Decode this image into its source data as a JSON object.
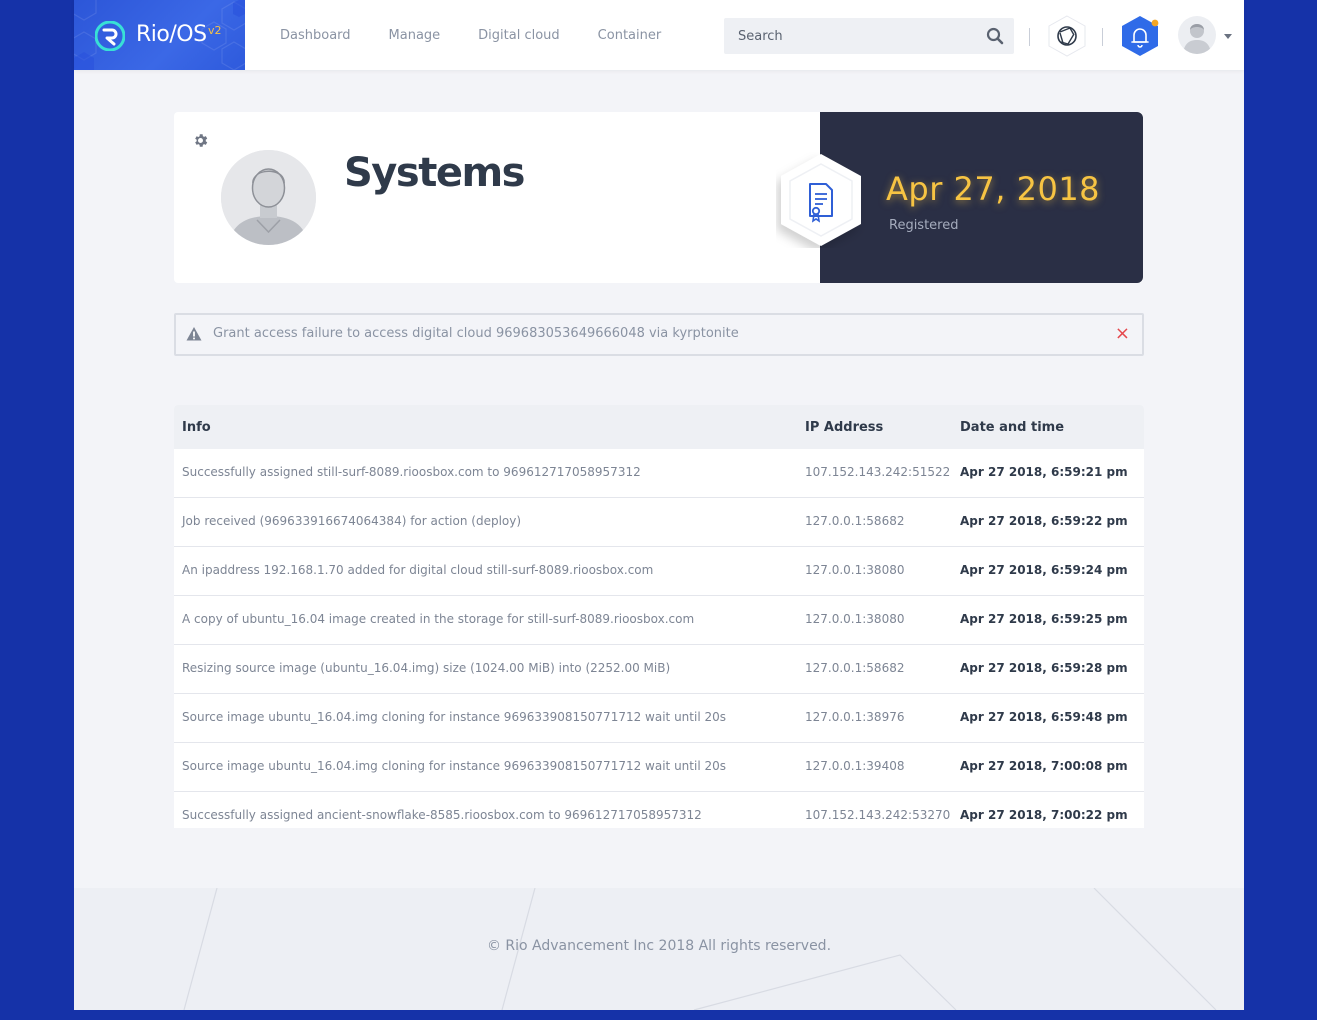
{
  "brand": {
    "name": "Rio/OS",
    "version": "v2"
  },
  "nav": [
    {
      "label": "Dashboard"
    },
    {
      "label": "Manage"
    },
    {
      "label": "Digital cloud"
    },
    {
      "label": "Container"
    }
  ],
  "search": {
    "placeholder": "Search",
    "value": ""
  },
  "profile": {
    "title": "Systems",
    "registered_date": "Apr 27, 2018",
    "registered_label": "Registered"
  },
  "alert": {
    "message": "Grant access failure to access digital cloud 969683053649666048 via kyrptonite",
    "close": "×"
  },
  "table": {
    "headers": {
      "info": "Info",
      "ip": "IP Address",
      "datetime": "Date and time"
    },
    "rows": [
      {
        "info": "Successfully assigned still-surf-8089.rioosbox.com to 969612717058957312",
        "ip": "107.152.143.242:51522",
        "datetime": "Apr 27 2018, 6:59:21 pm"
      },
      {
        "info": "Job received (969633916674064384) for action (deploy)",
        "ip": "127.0.0.1:58682",
        "datetime": "Apr 27 2018, 6:59:22 pm"
      },
      {
        "info": "An ipaddress 192.168.1.70 added for digital cloud still-surf-8089.rioosbox.com",
        "ip": "127.0.0.1:38080",
        "datetime": "Apr 27 2018, 6:59:24 pm"
      },
      {
        "info": "A copy of ubuntu_16.04 image created in the storage for still-surf-8089.rioosbox.com",
        "ip": "127.0.0.1:38080",
        "datetime": "Apr 27 2018, 6:59:25 pm"
      },
      {
        "info": "Resizing source image (ubuntu_16.04.img) size (1024.00 MiB) into (2252.00 MiB)",
        "ip": "127.0.0.1:58682",
        "datetime": "Apr 27 2018, 6:59:28 pm"
      },
      {
        "info": "Source image ubuntu_16.04.img cloning for instance 969633908150771712 wait until 20s",
        "ip": "127.0.0.1:38976",
        "datetime": "Apr 27 2018, 6:59:48 pm"
      },
      {
        "info": "Source image ubuntu_16.04.img cloning for instance 969633908150771712 wait until 20s",
        "ip": "127.0.0.1:39408",
        "datetime": "Apr 27 2018, 7:00:08 pm"
      },
      {
        "info": "Successfully assigned ancient-snowflake-8585.rioosbox.com to 969612717058957312",
        "ip": "107.152.143.242:53270",
        "datetime": "Apr 27 2018, 7:00:22 pm"
      }
    ]
  },
  "footer": {
    "text": "© Rio Advancement Inc 2018 All rights reserved."
  },
  "colors": {
    "accent": "#3b68e6",
    "brand_bg": "#1532a8",
    "registered_date": "#f7c443",
    "alert_close": "#e5484d",
    "notification_dot": "#f5a623",
    "card_dark": "#2a2f45"
  },
  "icons": {
    "logo": "rio-logo-icon",
    "search": "search-icon",
    "apps": "aperture-icon",
    "notifications": "bell-icon",
    "settings": "gear-icon",
    "registration": "certificate-document-icon",
    "alert": "warning-triangle-icon",
    "close": "close-icon"
  }
}
